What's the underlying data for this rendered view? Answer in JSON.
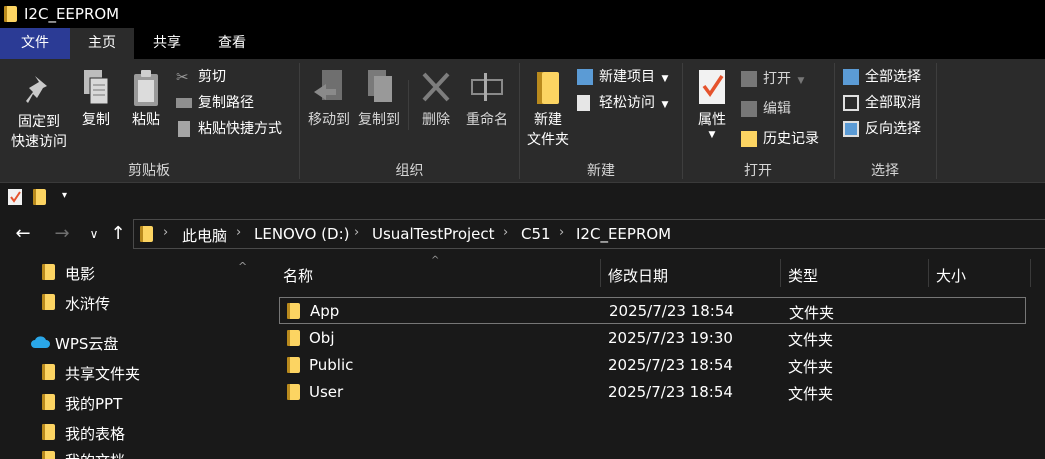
{
  "window": {
    "title": "I2C_EEPROM"
  },
  "tabs": {
    "file": "文件",
    "home": "主页",
    "share": "共享",
    "view": "查看"
  },
  "ribbon": {
    "clipboard": {
      "pin_line1": "固定到",
      "pin_line2": "快速访问",
      "copy": "复制",
      "paste": "粘贴",
      "cut": "剪切",
      "copy_path": "复制路径",
      "paste_shortcut": "粘贴快捷方式",
      "group": "剪贴板"
    },
    "organize": {
      "move_to": "移动到",
      "copy_to": "复制到",
      "delete": "删除",
      "rename": "重命名",
      "group": "组织"
    },
    "new": {
      "new_folder_line1": "新建",
      "new_folder_line2": "文件夹",
      "new_item": "新建项目",
      "easy_access": "轻松访问",
      "group": "新建"
    },
    "open": {
      "properties": "属性",
      "open": "打开",
      "edit": "编辑",
      "history": "历史记录",
      "group": "打开"
    },
    "select": {
      "select_all": "全部选择",
      "select_none": "全部取消",
      "invert": "反向选择",
      "group": "选择"
    }
  },
  "breadcrumb": [
    "此电脑",
    "LENOVO (D:)",
    "UsualTestProject",
    "C51",
    "I2C_EEPROM"
  ],
  "nav": {
    "items": [
      "电影",
      "水浒传",
      "WPS云盘",
      "共享文件夹",
      "我的PPT",
      "我的表格",
      "我的文档"
    ]
  },
  "columns": {
    "name": "名称",
    "date": "修改日期",
    "type": "类型",
    "size": "大小"
  },
  "files": [
    {
      "name": "App",
      "date": "2025/7/23 18:54",
      "type": "文件夹"
    },
    {
      "name": "Obj",
      "date": "2025/7/23 19:30",
      "type": "文件夹"
    },
    {
      "name": "Public",
      "date": "2025/7/23 18:54",
      "type": "文件夹"
    },
    {
      "name": "User",
      "date": "2025/7/23 18:54",
      "type": "文件夹"
    }
  ],
  "colors": {
    "file_tab": "#2b3b95",
    "ribbon_bg": "#2b2b2b",
    "background": "#191919",
    "folder": "#fcd462"
  }
}
